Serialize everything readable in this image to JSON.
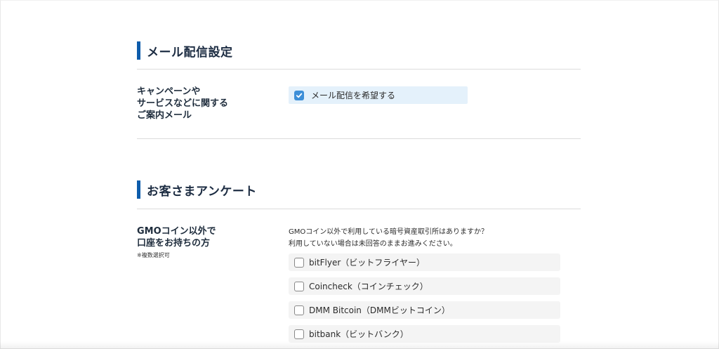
{
  "mail_section": {
    "title": "メール配信設定",
    "row_label_lines": [
      "キャンペーンや",
      "サービスなどに関する",
      "ご案内メール"
    ],
    "option": {
      "label": "メール配信を希望する",
      "checked": true
    }
  },
  "survey_section": {
    "title": "お客さまアンケート",
    "row_label_lines": [
      "GMOコイン以外で",
      "口座をお持ちの方"
    ],
    "row_note": "※複数選択可",
    "question_lines": [
      "GMOコイン以外で利用している暗号資産取引所はありますか？",
      "利用していない場合は未回答のままお進みください。"
    ],
    "options": [
      {
        "label": "bitFlyer（ビットフライヤー）",
        "checked": false
      },
      {
        "label": "Coincheck（コインチェック）",
        "checked": false
      },
      {
        "label": "DMM Bitcoin（DMMビットコイン）",
        "checked": false
      },
      {
        "label": "bitbank（ビットバンク）",
        "checked": false
      }
    ]
  },
  "colors": {
    "accent_bar": "#0d5cab",
    "checkbox_on": "#3d8fd8",
    "selected_option_bg": "#e4f1fb",
    "option_bg": "#f4f4f4"
  }
}
